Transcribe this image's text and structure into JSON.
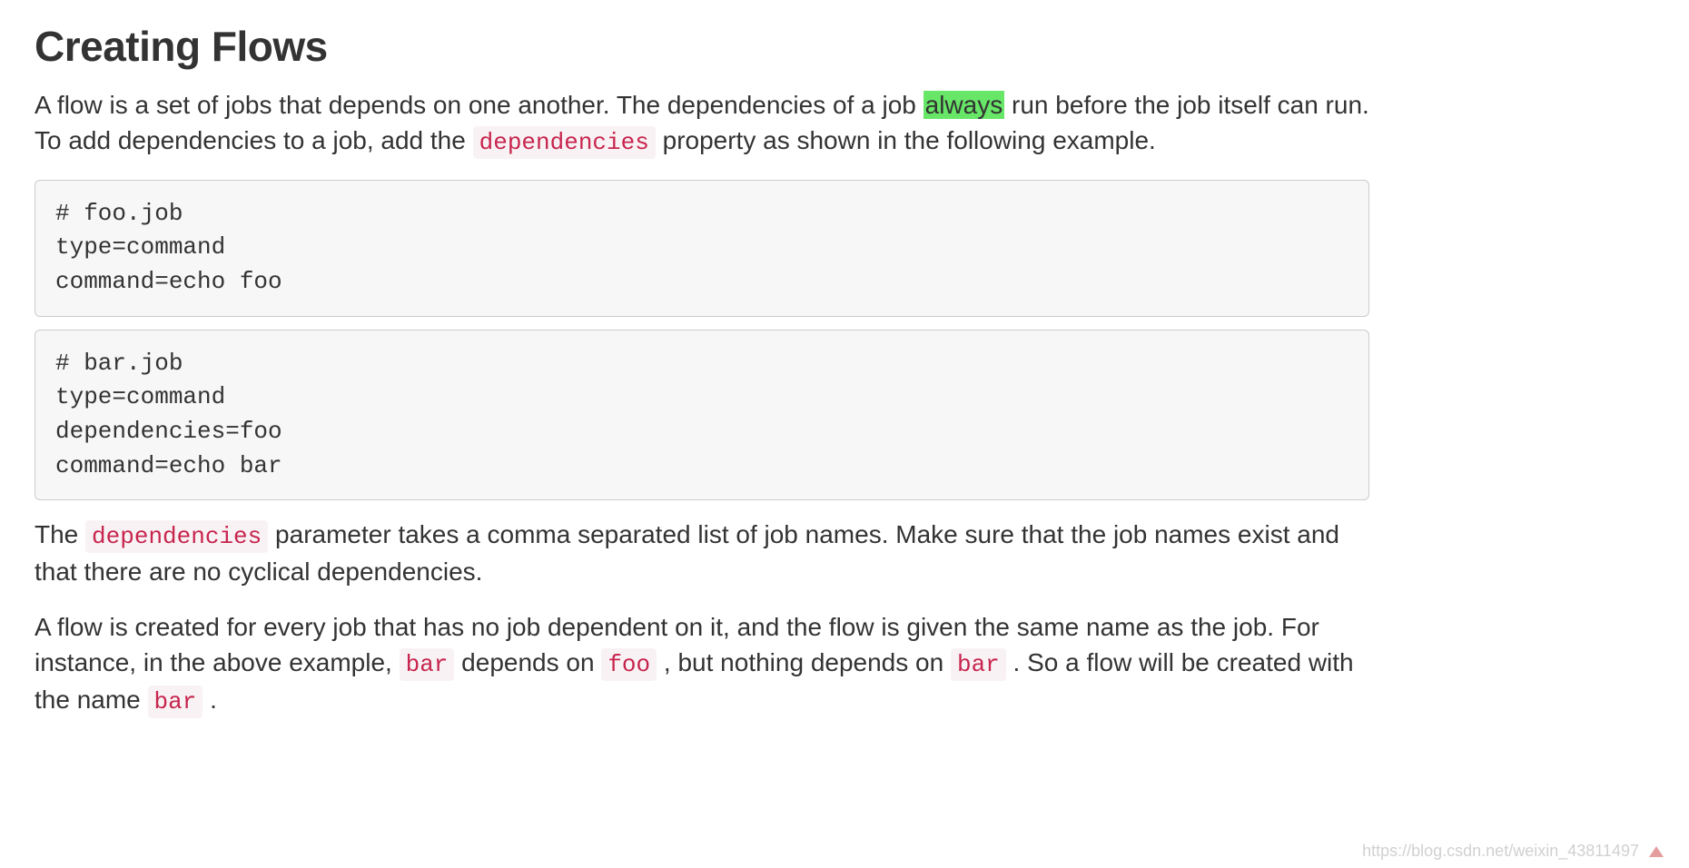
{
  "title": "Creating Flows",
  "para1": {
    "seg1": "A flow is a set of jobs that depends on one another. The dependencies of a job ",
    "highlight": "always",
    "seg2": " run before the job itself can run. To add dependencies to a job, add the ",
    "code": "dependencies",
    "seg3": " property as shown in the following example."
  },
  "code1": "# foo.job\ntype=command\ncommand=echo foo",
  "code2": "# bar.job\ntype=command\ndependencies=foo\ncommand=echo bar",
  "para2": {
    "seg1": "The ",
    "code": "dependencies",
    "seg2": " parameter takes a comma separated list of job names. Make sure that the job names exist and that there are no cyclical dependencies."
  },
  "para3": {
    "seg1": "A flow is created for every job that has no job dependent on it, and the flow is given the same name as the job. For instance, in the above example, ",
    "code1": "bar",
    "seg2": " depends on ",
    "code2": "foo",
    "seg3": " , but nothing depends on ",
    "code3": "bar",
    "seg4": " . So a flow will be created with the name ",
    "code4": "bar",
    "seg5": " ."
  },
  "watermark": "https://blog.csdn.net/weixin_43811497"
}
